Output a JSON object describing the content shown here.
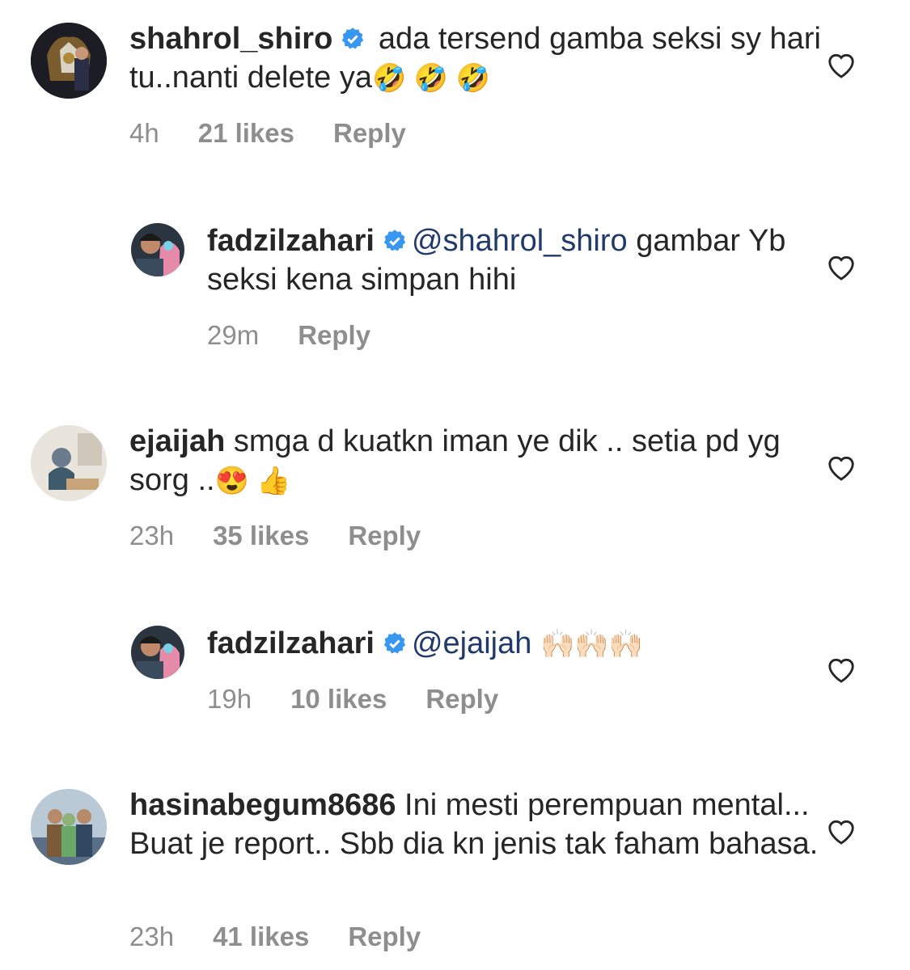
{
  "comments": [
    {
      "username": "shahrol_shiro",
      "verified": true,
      "text": "ada tersend gamba seksi sy hari tu..nanti delete ya",
      "emojis": "🤣 🤣 🤣",
      "time": "4h",
      "likes": "21 likes",
      "reply": "Reply",
      "avatar_icon": "crest-avatar"
    },
    {
      "username": "fadzilzahari",
      "verified": true,
      "mention": "@shahrol_shiro",
      "text": "gambar Yb seksi kena simpan hihi",
      "time": "29m",
      "reply": "Reply",
      "avatar_icon": "person-avatar"
    },
    {
      "username": "ejaijah",
      "verified": false,
      "text": "smga d kuatkn iman ye dik .. setia pd yg sorg ..",
      "emojis": "😍 👍",
      "time": "23h",
      "likes": "35 likes",
      "reply": "Reply",
      "avatar_icon": "person-avatar"
    },
    {
      "username": "fadzilzahari",
      "verified": true,
      "mention": "@ejaijah",
      "emojis": "🙌🏻🙌🏻🙌🏻",
      "time": "19h",
      "likes": "10 likes",
      "reply": "Reply",
      "avatar_icon": "person-avatar"
    },
    {
      "username": "hasinabegum8686",
      "verified": false,
      "text": "Ini mesti perempuan mental... Buat je report.. Sbb dia kn jenis tak faham bahasa.",
      "time": "23h",
      "likes": "41 likes",
      "reply": "Reply",
      "avatar_icon": "group-avatar"
    }
  ],
  "colors": {
    "verified_badge": "#3897f0",
    "mention": "#1f3a6b",
    "meta": "#8e8e8e",
    "heart": "#262626"
  }
}
